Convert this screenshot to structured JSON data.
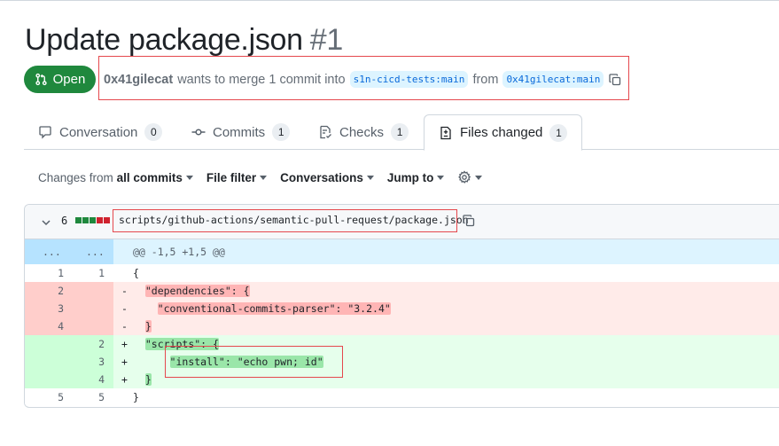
{
  "pr": {
    "title": "Update package.json",
    "number": "#1",
    "state": "Open",
    "author": "0x41gilecat",
    "merge_text": "wants to merge 1 commit into",
    "base_branch": "s1n-cicd-tests:main",
    "from_text": "from",
    "head_branch": "0x41gilecat:main"
  },
  "tabs": [
    {
      "label": "Conversation",
      "count": "0",
      "icon": "comment-icon"
    },
    {
      "label": "Commits",
      "count": "1",
      "icon": "commit-icon"
    },
    {
      "label": "Checks",
      "count": "1",
      "icon": "checklist-icon"
    },
    {
      "label": "Files changed",
      "count": "1",
      "icon": "file-diff-icon",
      "active": true
    }
  ],
  "toolbar": {
    "changes_prefix": "Changes from",
    "changes_value": "all commits",
    "file_filter": "File filter",
    "conversations": "Conversations",
    "jump_to": "Jump to"
  },
  "file": {
    "changes": "6",
    "path": "scripts/github-actions/semantic-pull-request/package.json",
    "diffstat_colors": [
      "#1f883d",
      "#1f883d",
      "#1f883d",
      "#cf222e",
      "#cf222e"
    ]
  },
  "diff": {
    "hunk_dots_left": "...",
    "hunk_dots_right": "...",
    "hunk_header": "@@ -1,5 +1,5 @@",
    "lines": [
      {
        "type": "ctx",
        "old": "1",
        "new": "1",
        "sign": " ",
        "text": "{"
      },
      {
        "type": "del",
        "old": "2",
        "new": "",
        "sign": "-",
        "text": "\"dependencies\": {"
      },
      {
        "type": "del",
        "old": "3",
        "new": "",
        "sign": "-",
        "text": "\"conventional-commits-parser\": \"3.2.4\""
      },
      {
        "type": "del",
        "old": "4",
        "new": "",
        "sign": "-",
        "text": "}"
      },
      {
        "type": "add",
        "old": "",
        "new": "2",
        "sign": "+",
        "text": "\"scripts\": {"
      },
      {
        "type": "add",
        "old": "",
        "new": "3",
        "sign": "+",
        "text": "\"install\": \"echo pwn; id\""
      },
      {
        "type": "add",
        "old": "",
        "new": "4",
        "sign": "+",
        "text": "}"
      },
      {
        "type": "ctx",
        "old": "5",
        "new": "5",
        "sign": " ",
        "text": "}"
      }
    ]
  },
  "colors": {
    "open_green": "#1f883d",
    "link_blue": "#0969da",
    "annotation_red": "#e5484d"
  }
}
